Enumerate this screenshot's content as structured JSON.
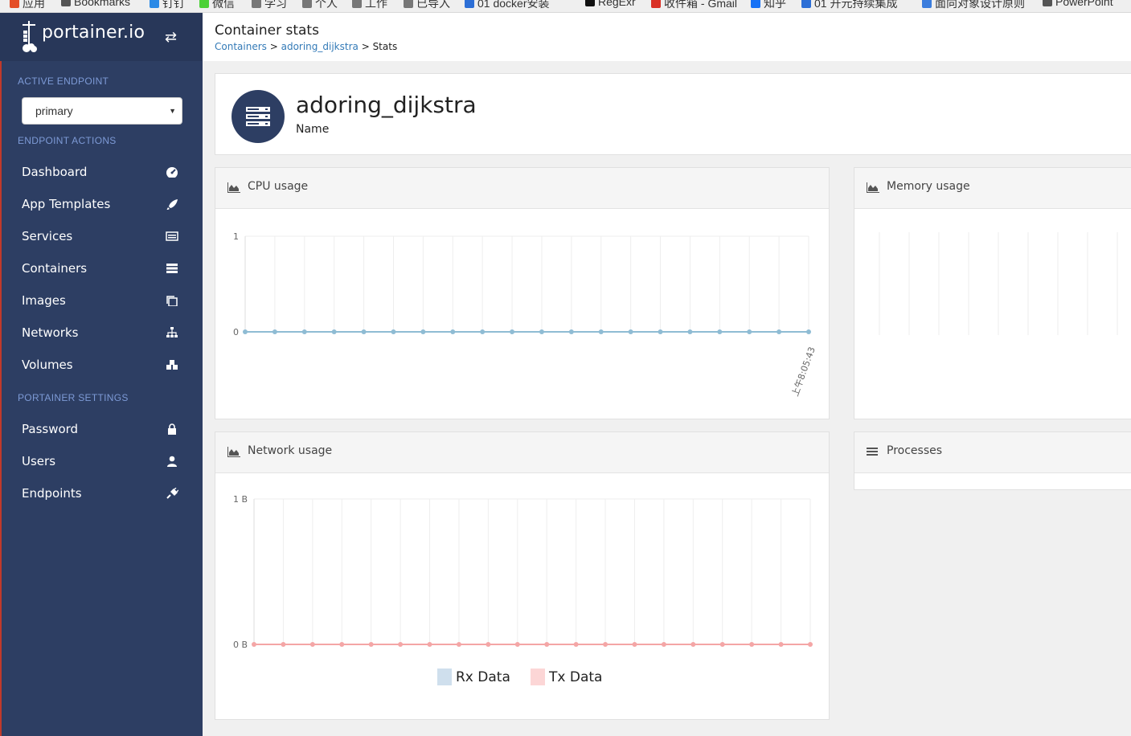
{
  "bookmarks": [
    {
      "label": "应用",
      "color": "#e44d26"
    },
    {
      "label": "Bookmarks",
      "color": "#555555"
    },
    {
      "label": "钉钉",
      "color": "#2b8ae6"
    },
    {
      "label": "微信",
      "color": "#4cd137"
    },
    {
      "label": "学习",
      "color": "#777777"
    },
    {
      "label": "个人",
      "color": "#777777"
    },
    {
      "label": "工作",
      "color": "#777777"
    },
    {
      "label": "已导入",
      "color": "#777777"
    },
    {
      "label": "01 docker安装",
      "color": "#2d6fd6"
    },
    {
      "label": "RegExr",
      "color": "#111111"
    },
    {
      "label": "收件箱 - Gmail",
      "color": "#d93025"
    },
    {
      "label": "知乎",
      "color": "#1772f6"
    },
    {
      "label": "01 开元持续集成",
      "color": "#2d6fd6"
    },
    {
      "label": "面向对象设计原则",
      "color": "#3b7ddd"
    },
    {
      "label": "PowerPoint",
      "color": "#555555"
    }
  ],
  "sidebar": {
    "brand": "portainer.io",
    "active_endpoint_heading": "ACTIVE ENDPOINT",
    "endpoint_selected": "primary",
    "endpoint_actions_heading": "ENDPOINT ACTIONS",
    "actions": [
      {
        "label": "Dashboard",
        "icon": "dashboard-icon"
      },
      {
        "label": "App Templates",
        "icon": "rocket-icon"
      },
      {
        "label": "Services",
        "icon": "services-list-icon"
      },
      {
        "label": "Containers",
        "icon": "server-icon"
      },
      {
        "label": "Images",
        "icon": "clone-icon"
      },
      {
        "label": "Networks",
        "icon": "sitemap-icon"
      },
      {
        "label": "Volumes",
        "icon": "cubes-icon"
      }
    ],
    "settings_heading": "PORTAINER SETTINGS",
    "settings": [
      {
        "label": "Password",
        "icon": "lock-icon"
      },
      {
        "label": "Users",
        "icon": "user-icon"
      },
      {
        "label": "Endpoints",
        "icon": "plug-icon"
      }
    ]
  },
  "header": {
    "title": "Container stats",
    "breadcrumb": {
      "first": "Containers",
      "sep1": " > ",
      "second": "adoring_dijkstra",
      "sep2": " > ",
      "current": "Stats"
    }
  },
  "container": {
    "name": "adoring_dijkstra",
    "name_label": "Name"
  },
  "panels": {
    "cpu_title": "CPU usage",
    "memory_title": "Memory usage",
    "network_title": "Network usage",
    "processes_title": "Processes"
  },
  "colors": {
    "sidebar": "#2d3e63",
    "link": "#337ab7",
    "cpu_line": "#8fbcd4",
    "tx_line": "#f4a6a6"
  },
  "chart_data": [
    {
      "type": "line",
      "title": "CPU usage",
      "ylim": [
        0,
        1
      ],
      "yticks": [
        "0",
        "1"
      ],
      "x_last_tick_label": "上午8:05:43",
      "series": [
        {
          "values": [
            0,
            0,
            0,
            0,
            0,
            0,
            0,
            0,
            0,
            0,
            0,
            0,
            0,
            0,
            0,
            0,
            0,
            0,
            0,
            0
          ]
        }
      ]
    },
    {
      "type": "line",
      "title": "Network usage",
      "ylim": [
        0,
        1
      ],
      "yticks": [
        "0 B",
        "1 B"
      ],
      "legend": "bottom",
      "series": [
        {
          "name": "Rx Data",
          "color": "#cfdfed",
          "values": [
            0,
            0,
            0,
            0,
            0,
            0,
            0,
            0,
            0,
            0,
            0,
            0,
            0,
            0,
            0,
            0,
            0,
            0,
            0,
            0
          ]
        },
        {
          "name": "Tx Data",
          "color": "#fcd6d6",
          "values": [
            0,
            0,
            0,
            0,
            0,
            0,
            0,
            0,
            0,
            0,
            0,
            0,
            0,
            0,
            0,
            0,
            0,
            0,
            0,
            0
          ]
        }
      ]
    }
  ]
}
